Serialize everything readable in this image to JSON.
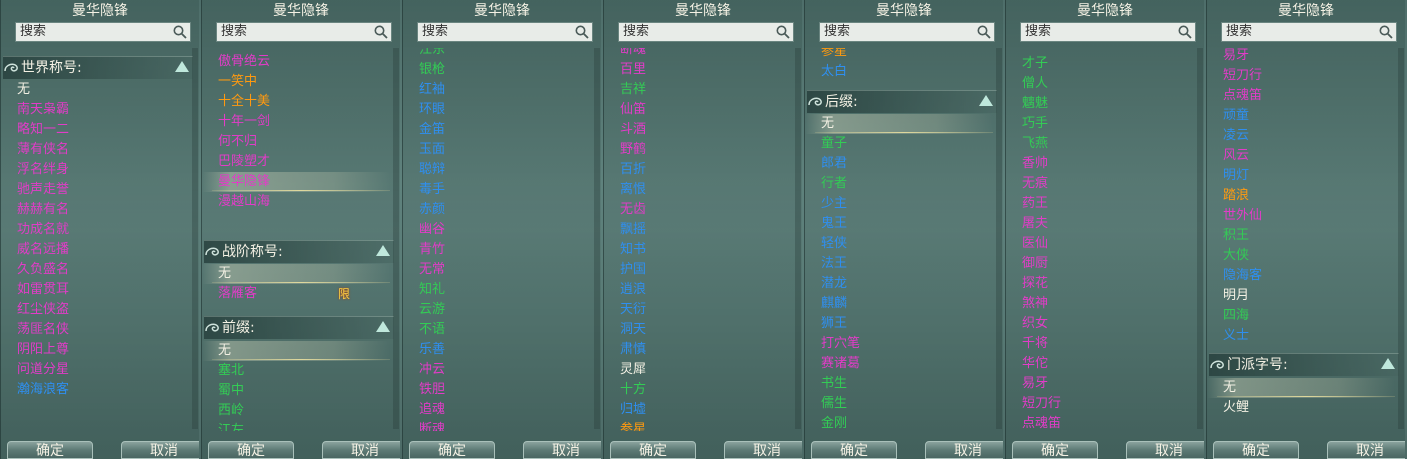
{
  "colors": {
    "white": "#f4f1e4",
    "magenta": "#e23cc8",
    "blue": "#2f8ff0",
    "green": "#33cc55",
    "orange": "#ff9a10"
  },
  "panels": [
    {
      "title": "曼华隐锋",
      "search_placeholder": "搜索",
      "confirm": "确定",
      "cancel": "取消",
      "header": "世界称号:",
      "items": [
        {
          "text": "无",
          "c": "white",
          "sel": false
        },
        {
          "text": "南天枭霸",
          "c": "mag"
        },
        {
          "text": "略知一二",
          "c": "mag"
        },
        {
          "text": "薄有侠名",
          "c": "mag"
        },
        {
          "text": "浮名绊身",
          "c": "mag"
        },
        {
          "text": "驰声走誉",
          "c": "mag"
        },
        {
          "text": "赫赫有名",
          "c": "mag"
        },
        {
          "text": "功成名就",
          "c": "mag"
        },
        {
          "text": "威名远播",
          "c": "mag"
        },
        {
          "text": "久负盛名",
          "c": "mag"
        },
        {
          "text": "如雷贯耳",
          "c": "mag"
        },
        {
          "text": "红尘侠盗",
          "c": "mag"
        },
        {
          "text": "荡匪名侠",
          "c": "mag"
        },
        {
          "text": "阴阳上尊",
          "c": "mag"
        },
        {
          "text": "问道分星",
          "c": "mag"
        },
        {
          "text": "瀚海浪客",
          "c": "blue"
        }
      ]
    },
    {
      "title": "曼华隐锋",
      "search_placeholder": "搜索",
      "confirm": "确定",
      "cancel": "取消",
      "items1": [
        {
          "text": "傲骨绝云",
          "c": "mag"
        },
        {
          "text": "一笑中",
          "c": "orange"
        },
        {
          "text": "十全十美",
          "c": "orange"
        },
        {
          "text": "十年一剑",
          "c": "mag"
        },
        {
          "text": "何不归",
          "c": "mag"
        },
        {
          "text": "巴陵塑才",
          "c": "mag"
        },
        {
          "text": "曼华隐锋",
          "c": "mag",
          "sel": true
        },
        {
          "text": "漫越山海",
          "c": "mag"
        }
      ],
      "header2": "战阶称号:",
      "items2": [
        {
          "text": "无",
          "c": "white",
          "sel": true
        },
        {
          "text": "落雁客",
          "c": "mag",
          "badge": "限"
        }
      ],
      "header3": "前缀:",
      "items3": [
        {
          "text": "无",
          "c": "white",
          "sel": true
        },
        {
          "text": "塞北",
          "c": "green"
        },
        {
          "text": "蜀中",
          "c": "green"
        },
        {
          "text": "西岭",
          "c": "green"
        },
        {
          "text": "江左",
          "c": "green"
        }
      ]
    },
    {
      "title": "曼华隐锋",
      "search_placeholder": "搜索",
      "confirm": "确定",
      "cancel": "取消",
      "items": [
        {
          "text": "江东",
          "c": "green"
        },
        {
          "text": "银枪",
          "c": "green"
        },
        {
          "text": "红袖",
          "c": "blue"
        },
        {
          "text": "环眼",
          "c": "blue"
        },
        {
          "text": "金笛",
          "c": "blue"
        },
        {
          "text": "玉面",
          "c": "blue"
        },
        {
          "text": "聪辩",
          "c": "blue"
        },
        {
          "text": "毒手",
          "c": "blue"
        },
        {
          "text": "赤颜",
          "c": "blue"
        },
        {
          "text": "幽谷",
          "c": "mag"
        },
        {
          "text": "青竹",
          "c": "mag"
        },
        {
          "text": "无常",
          "c": "mag"
        },
        {
          "text": "知礼",
          "c": "green"
        },
        {
          "text": "云游",
          "c": "green"
        },
        {
          "text": "不语",
          "c": "green"
        },
        {
          "text": "乐善",
          "c": "blue"
        },
        {
          "text": "冲云",
          "c": "mag"
        },
        {
          "text": "铁胆",
          "c": "mag"
        },
        {
          "text": "追魂",
          "c": "mag"
        },
        {
          "text": "断魂",
          "c": "mag"
        }
      ]
    },
    {
      "title": "曼华隐锋",
      "search_placeholder": "搜索",
      "confirm": "确定",
      "cancel": "取消",
      "items": [
        {
          "text": "断魂",
          "c": "mag"
        },
        {
          "text": "百里",
          "c": "mag"
        },
        {
          "text": "吉祥",
          "c": "green"
        },
        {
          "text": "仙笛",
          "c": "mag"
        },
        {
          "text": "斗酒",
          "c": "mag"
        },
        {
          "text": "野鹤",
          "c": "mag"
        },
        {
          "text": "百折",
          "c": "blue"
        },
        {
          "text": "离恨",
          "c": "blue"
        },
        {
          "text": "无齿",
          "c": "mag"
        },
        {
          "text": "飘摇",
          "c": "blue"
        },
        {
          "text": "知书",
          "c": "blue"
        },
        {
          "text": "护国",
          "c": "blue"
        },
        {
          "text": "逍浪",
          "c": "blue"
        },
        {
          "text": "天衍",
          "c": "blue"
        },
        {
          "text": "洞天",
          "c": "blue"
        },
        {
          "text": "肃慎",
          "c": "blue"
        },
        {
          "text": "灵犀",
          "c": "white"
        },
        {
          "text": "十方",
          "c": "green"
        },
        {
          "text": "归墟",
          "c": "blue"
        },
        {
          "text": "参星",
          "c": "orange"
        }
      ]
    },
    {
      "title": "曼华隐锋",
      "search_placeholder": "搜索",
      "confirm": "确定",
      "cancel": "取消",
      "items1": [
        {
          "text": "参星",
          "c": "orange"
        },
        {
          "text": "太白",
          "c": "blue"
        }
      ],
      "header2": "后缀:",
      "items2": [
        {
          "text": "无",
          "c": "white",
          "sel": true
        },
        {
          "text": "童子",
          "c": "green"
        },
        {
          "text": "郎君",
          "c": "blue"
        },
        {
          "text": "行者",
          "c": "green"
        },
        {
          "text": "少主",
          "c": "blue"
        },
        {
          "text": "鬼王",
          "c": "blue"
        },
        {
          "text": "轻侠",
          "c": "blue"
        },
        {
          "text": "法王",
          "c": "blue"
        },
        {
          "text": "潜龙",
          "c": "blue"
        },
        {
          "text": "麒麟",
          "c": "blue"
        },
        {
          "text": "狮王",
          "c": "blue"
        },
        {
          "text": "打穴笔",
          "c": "mag"
        },
        {
          "text": "赛诸葛",
          "c": "mag"
        },
        {
          "text": "书生",
          "c": "green"
        },
        {
          "text": "儒生",
          "c": "green"
        },
        {
          "text": "金刚",
          "c": "green"
        }
      ]
    },
    {
      "title": "曼华隐锋",
      "search_placeholder": "搜索",
      "confirm": "确定",
      "cancel": "取消",
      "items": [
        {
          "text": "才子",
          "c": "green"
        },
        {
          "text": "僧人",
          "c": "green"
        },
        {
          "text": "魑魅",
          "c": "green"
        },
        {
          "text": "巧手",
          "c": "green"
        },
        {
          "text": "飞燕",
          "c": "green"
        },
        {
          "text": "香帅",
          "c": "mag"
        },
        {
          "text": "无痕",
          "c": "mag"
        },
        {
          "text": "药王",
          "c": "mag"
        },
        {
          "text": "屠夫",
          "c": "mag"
        },
        {
          "text": "医仙",
          "c": "mag"
        },
        {
          "text": "御厨",
          "c": "mag"
        },
        {
          "text": "探花",
          "c": "mag"
        },
        {
          "text": "煞神",
          "c": "mag"
        },
        {
          "text": "织女",
          "c": "mag"
        },
        {
          "text": "千将",
          "c": "mag"
        },
        {
          "text": "华佗",
          "c": "mag"
        },
        {
          "text": "易牙",
          "c": "mag"
        },
        {
          "text": "短刀行",
          "c": "mag"
        },
        {
          "text": "点魂笛",
          "c": "mag"
        }
      ]
    },
    {
      "title": "曼华隐锋",
      "search_placeholder": "搜索",
      "confirm": "确定",
      "cancel": "取消",
      "items1": [
        {
          "text": "易牙",
          "c": "mag"
        },
        {
          "text": "短刀行",
          "c": "mag"
        },
        {
          "text": "点魂笛",
          "c": "mag"
        },
        {
          "text": "顽童",
          "c": "blue"
        },
        {
          "text": "凌云",
          "c": "blue"
        },
        {
          "text": "风云",
          "c": "mag"
        },
        {
          "text": "明灯",
          "c": "blue"
        },
        {
          "text": "踏浪",
          "c": "orange"
        },
        {
          "text": "世外仙",
          "c": "mag"
        },
        {
          "text": "积王",
          "c": "green"
        },
        {
          "text": "大侠",
          "c": "green"
        },
        {
          "text": "隐海客",
          "c": "blue"
        },
        {
          "text": "明月",
          "c": "white"
        },
        {
          "text": "四海",
          "c": "green"
        },
        {
          "text": "义士",
          "c": "blue"
        }
      ],
      "header2": "门派字号:",
      "items2": [
        {
          "text": "无",
          "c": "white",
          "sel": true
        },
        {
          "text": "火鲤",
          "c": "white"
        }
      ]
    }
  ]
}
